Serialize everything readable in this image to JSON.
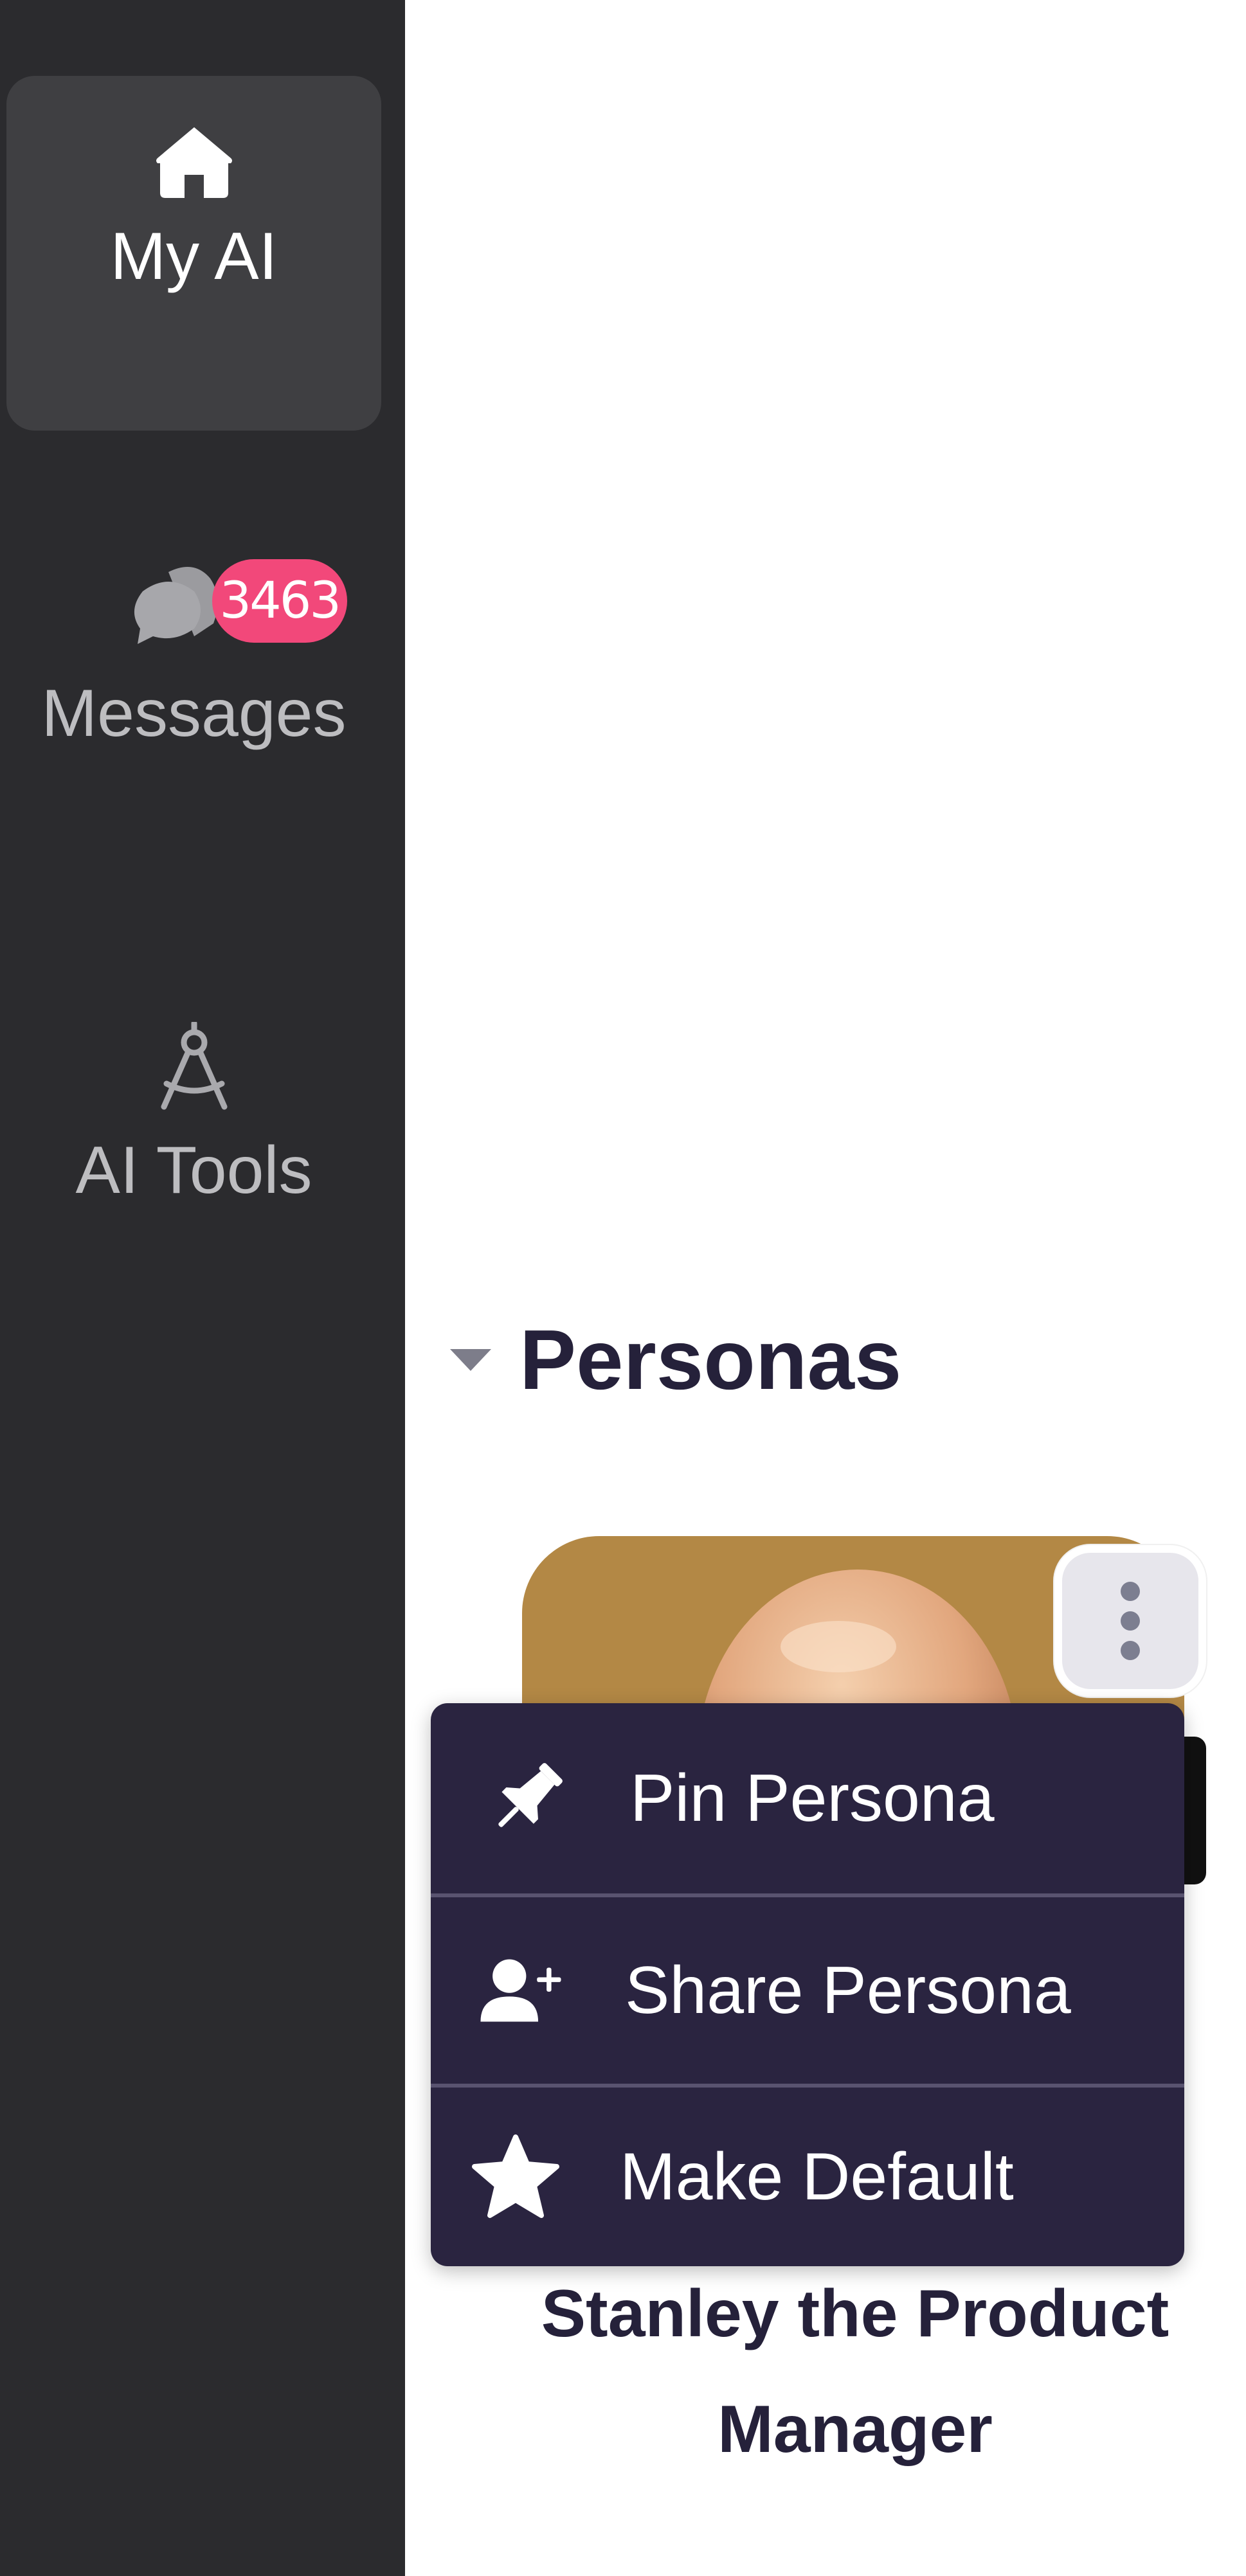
{
  "sidebar": {
    "items": [
      {
        "label": "My AI",
        "icon": "home-icon",
        "active": true
      },
      {
        "label": "Messages",
        "icon": "chat-bubbles-icon",
        "badge": "3463"
      },
      {
        "label": "AI Tools",
        "icon": "compass-tool-icon"
      }
    ]
  },
  "main": {
    "section_title": "Personas",
    "persona": {
      "name_line1": "Stanley the Product",
      "name_line2": "Manager"
    },
    "menu": {
      "items": [
        {
          "label": "Pin Persona",
          "icon": "pin-icon"
        },
        {
          "label": "Share Persona",
          "icon": "add-user-icon"
        },
        {
          "label": "Make Default",
          "icon": "star-icon"
        }
      ]
    }
  },
  "colors": {
    "sidebar_bg": "#2b2b2e",
    "active_item_bg": "#3f3f42",
    "badge": "#f2487a",
    "menu_bg": "#2a2440",
    "title_text": "#25213a",
    "card_bg": "#b38845"
  }
}
